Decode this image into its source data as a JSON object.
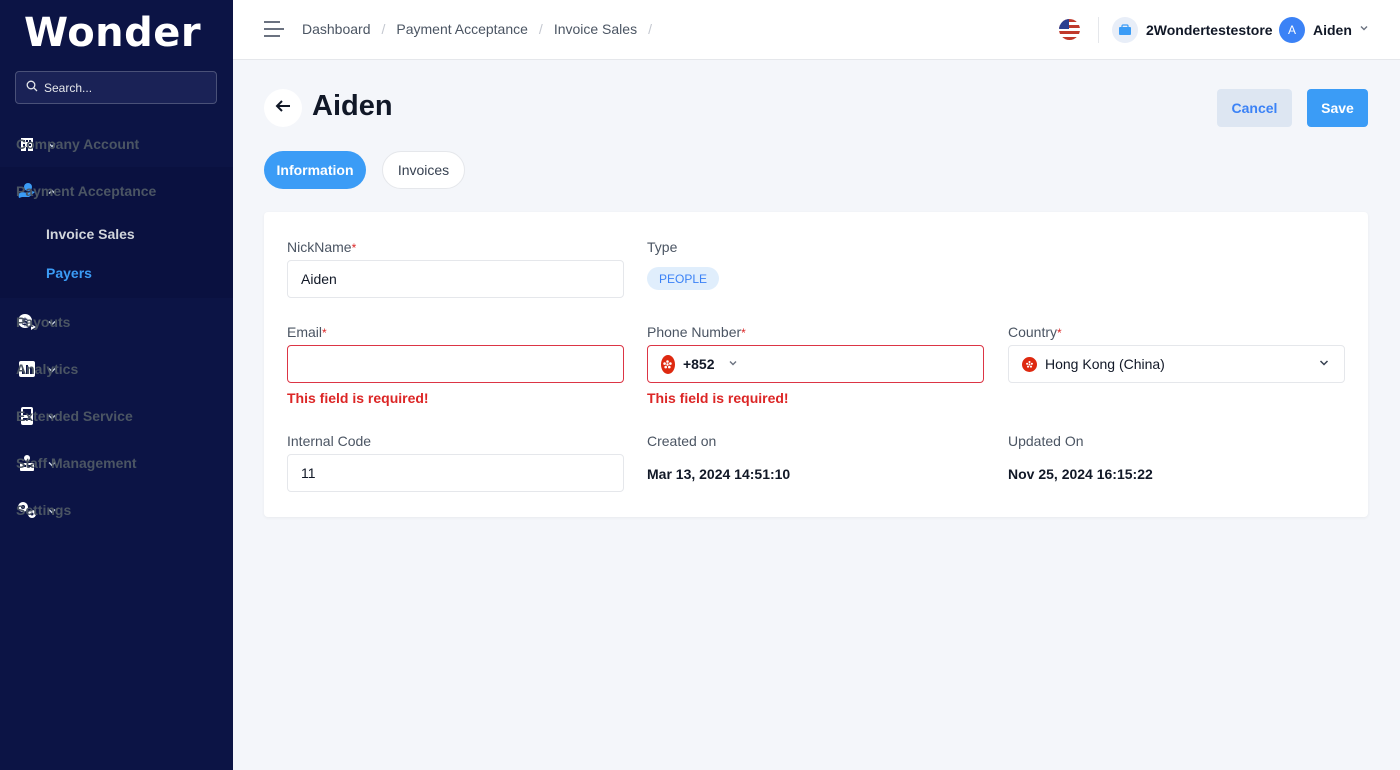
{
  "sidebar": {
    "logo": "Wonder",
    "search_placeholder": "Search...",
    "items": [
      {
        "label": "Company Account",
        "icon": "building-icon"
      },
      {
        "label": "Payment Acceptance",
        "icon": "hand-payment-icon",
        "expanded": true,
        "children": [
          {
            "label": "Invoice Sales"
          },
          {
            "label": "Payers",
            "active": true
          }
        ]
      },
      {
        "label": "Payouts",
        "icon": "payouts-icon"
      },
      {
        "label": "Analytics",
        "icon": "analytics-icon"
      },
      {
        "label": "Extended Service",
        "icon": "terminal-icon"
      },
      {
        "label": "Staff Management",
        "icon": "staff-icon"
      },
      {
        "label": "Settings",
        "icon": "gears-icon"
      }
    ]
  },
  "topbar": {
    "breadcrumbs": [
      "Dashboard",
      "Payment Acceptance",
      "Invoice Sales"
    ],
    "store_name": "2Wondertestestore",
    "user_initial": "A",
    "user_name": "Aiden"
  },
  "page": {
    "title": "Aiden",
    "cancel_label": "Cancel",
    "save_label": "Save",
    "tabs": [
      {
        "label": "Information",
        "active": true
      },
      {
        "label": "Invoices"
      }
    ]
  },
  "form": {
    "nickname": {
      "label": "NickName",
      "required": "*",
      "value": "Aiden"
    },
    "type": {
      "label": "Type",
      "value": "PEOPLE"
    },
    "email": {
      "label": "Email",
      "required": "*",
      "value": "",
      "error": "This field is required!"
    },
    "phone": {
      "label": "Phone Number",
      "required": "*",
      "country_code": "+852",
      "value": "",
      "error": "This field is required!"
    },
    "country": {
      "label": "Country",
      "required": "*",
      "value": "Hong Kong (China)"
    },
    "internal_code": {
      "label": "Internal Code",
      "value": "11"
    },
    "created_on": {
      "label": "Created on",
      "value": "Mar 13, 2024 14:51:10"
    },
    "updated_on": {
      "label": "Updated On",
      "value": "Nov 25, 2024 16:15:22"
    }
  },
  "colors": {
    "sidebar_bg": "#0c1445",
    "accent": "#3b9cf6",
    "error": "#dc2626"
  }
}
